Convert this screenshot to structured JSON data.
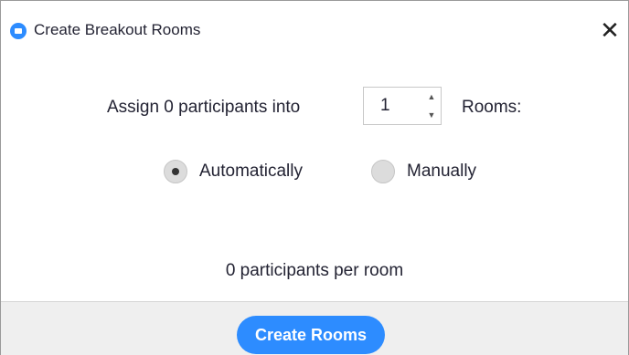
{
  "window": {
    "title": "Create Breakout Rooms",
    "close_glyph": "✕",
    "app_icon": "zoom-icon"
  },
  "assign": {
    "label": "Assign 0 participants into",
    "room_count": "1",
    "rooms_label": "Rooms:",
    "spin_up": "▲",
    "spin_down": "▼"
  },
  "mode": {
    "options": [
      {
        "label": "Automatically",
        "checked": true
      },
      {
        "label": "Manually",
        "checked": false
      }
    ]
  },
  "summary": {
    "per_room_text": "0 participants per room"
  },
  "footer": {
    "create_label": "Create Rooms"
  },
  "colors": {
    "accent": "#2d8cff",
    "footer_bg": "#efefef"
  }
}
